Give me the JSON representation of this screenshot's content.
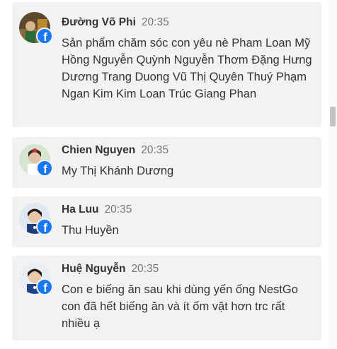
{
  "comments": [
    {
      "author": "Đường Võ Phi",
      "time": "20:35",
      "text": "Sản phẩm chăm sóc con yêu nè Pham Loan Mỹ Hồng Nguyễn Quỳnh Nguyễn Thơm Đặng Hưng Dương Trang Duong Vũ Thị Quyên Thuý Phạm Ngan Kim Kim Loan Trúc Giang Phan"
    },
    {
      "author": "Chien Nguyen",
      "time": "20:35",
      "text": "My Thị Khánh Dương"
    },
    {
      "author": "Ha Luu",
      "time": "20:35",
      "text": "Thu Huyền"
    },
    {
      "author": "Huệ Nguyễn",
      "time": "20:35",
      "text": "Con e biếng ăn sau khi dùng yến ống NestGo con đã hết biếng ăn và ít ốm vặt hơn trc rất nhiều ạ"
    }
  ],
  "badge_icon": "facebook-icon",
  "colors": {
    "card_bg": "#f2f2f2",
    "facebook_blue": "#1877f2",
    "text": "#333333",
    "time": "#777777"
  }
}
